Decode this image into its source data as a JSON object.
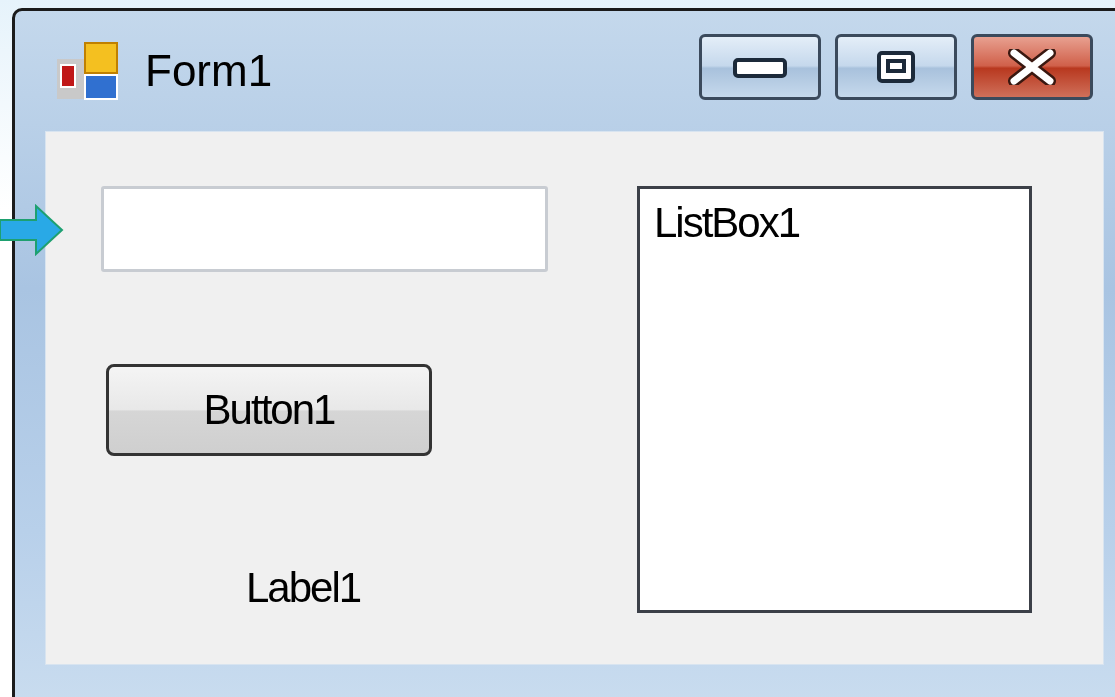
{
  "window": {
    "title": "Form1"
  },
  "text_box": {
    "kind": "textbox"
  },
  "button": {
    "label": "Button1"
  },
  "label": {
    "text": "Label1"
  },
  "list_box": {
    "items": [
      "ListBox1"
    ]
  }
}
